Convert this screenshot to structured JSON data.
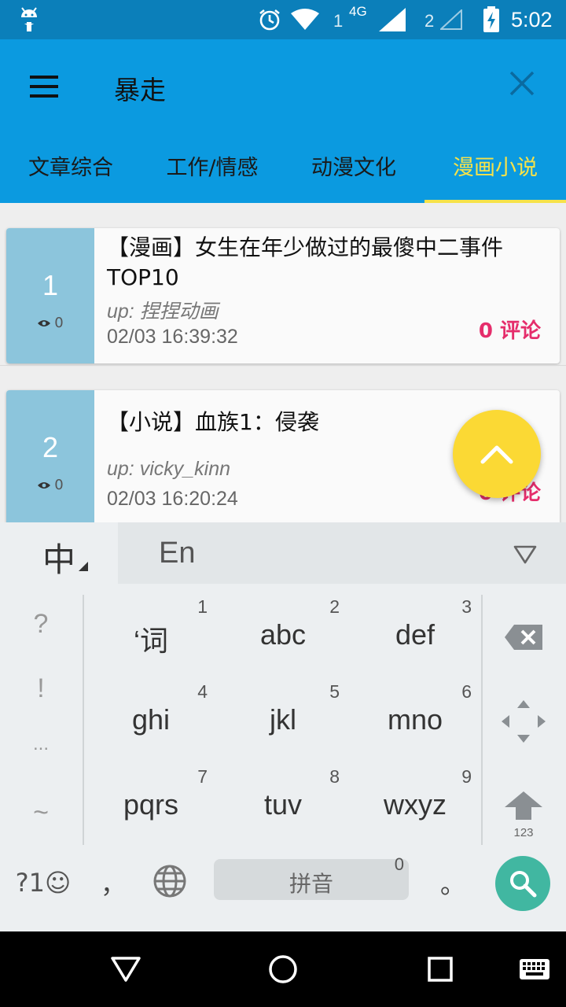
{
  "status_bar": {
    "sim1_label": "1",
    "network_type": "4G",
    "sim2_label": "2",
    "time": "5:02",
    "icons": [
      "android-icon",
      "alarm-icon",
      "wifi-icon",
      "signal-icon",
      "signal-empty-icon",
      "battery-charging-icon"
    ]
  },
  "toolbar": {
    "title": "暴走",
    "menu_icon": "menu-icon",
    "close_icon": "close-icon"
  },
  "tabs": [
    {
      "label": "文章综合",
      "active": false
    },
    {
      "label": "工作/情感",
      "active": false
    },
    {
      "label": "动漫文化",
      "active": false
    },
    {
      "label": "漫画小说",
      "active": true
    }
  ],
  "articles": [
    {
      "rank": "1",
      "views": "0",
      "title": "【漫画】女生在年少做过的最傻中二事件TOP10",
      "up": "up: 捏捏动画",
      "time": "02/03 16:39:32",
      "comments": "0 评论"
    },
    {
      "rank": "2",
      "views": "0",
      "title": "【小说】血族1：侵袭",
      "up": "up: vicky_kinn",
      "time": "02/03 16:20:24",
      "comments": "0 评论"
    }
  ],
  "fab": {
    "icon": "chevron-up-icon"
  },
  "keyboard": {
    "lang_zh": "中",
    "lang_en": "En",
    "side_symbols": [
      "?",
      "!",
      "...",
      "~"
    ],
    "keys": [
      {
        "label": "‘词",
        "num": "1"
      },
      {
        "label": "abc",
        "num": "2"
      },
      {
        "label": "def",
        "num": "3"
      },
      {
        "label": "ghi",
        "num": "4"
      },
      {
        "label": "jkl",
        "num": "5"
      },
      {
        "label": "mno",
        "num": "6"
      },
      {
        "label": "pqrs",
        "num": "7"
      },
      {
        "label": "tuv",
        "num": "8"
      },
      {
        "label": "wxyz",
        "num": "9"
      }
    ],
    "shift_label": "123",
    "symbols_key": "?1☺",
    "comma_key": "，",
    "space_label": "拼音",
    "space_num": "0",
    "period_key": "。"
  },
  "colors": {
    "status_bar": "#0b7fba",
    "toolbar": "#0b9ae0",
    "tab_active": "#f6e24a",
    "rank_bg": "#8cc5dc",
    "comments": "#e52d6b",
    "fab": "#fbd934",
    "search_button": "#41b7a1"
  }
}
